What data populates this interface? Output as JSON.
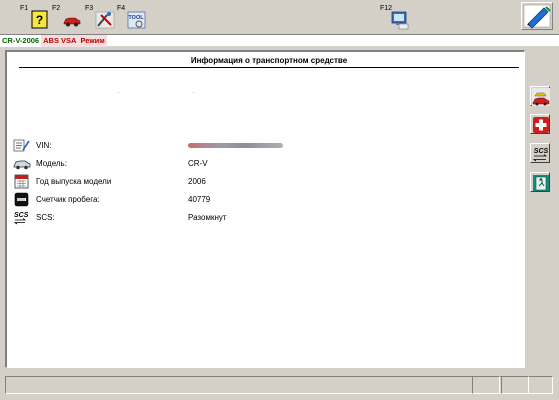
{
  "toolbar": {
    "keys": [
      {
        "label": "F1",
        "icon": "help-icon"
      },
      {
        "label": "F2",
        "icon": "car-icon"
      },
      {
        "label": "F3",
        "icon": "tools-icon"
      },
      {
        "label": "F4",
        "icon": "tool-card-icon"
      },
      {
        "label": "F12",
        "icon": "monitor-print-icon"
      }
    ],
    "settings_icon": "pen-settings-icon"
  },
  "status": {
    "model": "CR-V-2006",
    "system": "ABS VSA",
    "mode": "Режим"
  },
  "panel": {
    "title": "Информация о транспортном средстве",
    "rows": [
      {
        "icon": "vin-icon",
        "label": "VIN:",
        "value": ""
      },
      {
        "icon": "car-model-icon",
        "label": "Модель:",
        "value": "CR-V"
      },
      {
        "icon": "calendar-icon",
        "label": "Год выпуска модели",
        "value": "2006"
      },
      {
        "icon": "odometer-icon",
        "label": "Счетчик пробега:",
        "value": "40779"
      },
      {
        "icon": "scs-icon",
        "label": "SCS:",
        "value": "Разомкнут"
      }
    ]
  },
  "side_buttons": [
    {
      "icon": "vehicle-info-icon"
    },
    {
      "icon": "first-aid-icon"
    },
    {
      "icon": "scs-connector-icon",
      "text": "SCS"
    },
    {
      "icon": "exit-door-icon"
    }
  ],
  "colors": {
    "chrome": "#d4d0c8",
    "model_green": "#006400",
    "alert_red": "#c00000"
  }
}
